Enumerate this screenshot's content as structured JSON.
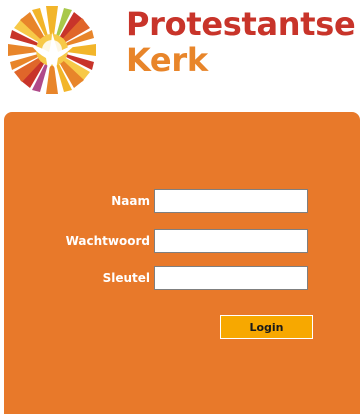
{
  "brand": {
    "name_line1": "Protestantse",
    "name_line2": "Kerk",
    "logo_icon": "dove-sunburst-icon",
    "colors": {
      "red": "#c8342a",
      "orange": "#e8852a",
      "panel": "#e8792a",
      "button": "#f7a800"
    }
  },
  "login_form": {
    "naam_label": "Naam",
    "naam_value": "",
    "wachtwoord_label": "Wachtwoord",
    "wachtwoord_value": "",
    "sleutel_label": "Sleutel",
    "sleutel_value": "",
    "login_button_label": "Login"
  }
}
